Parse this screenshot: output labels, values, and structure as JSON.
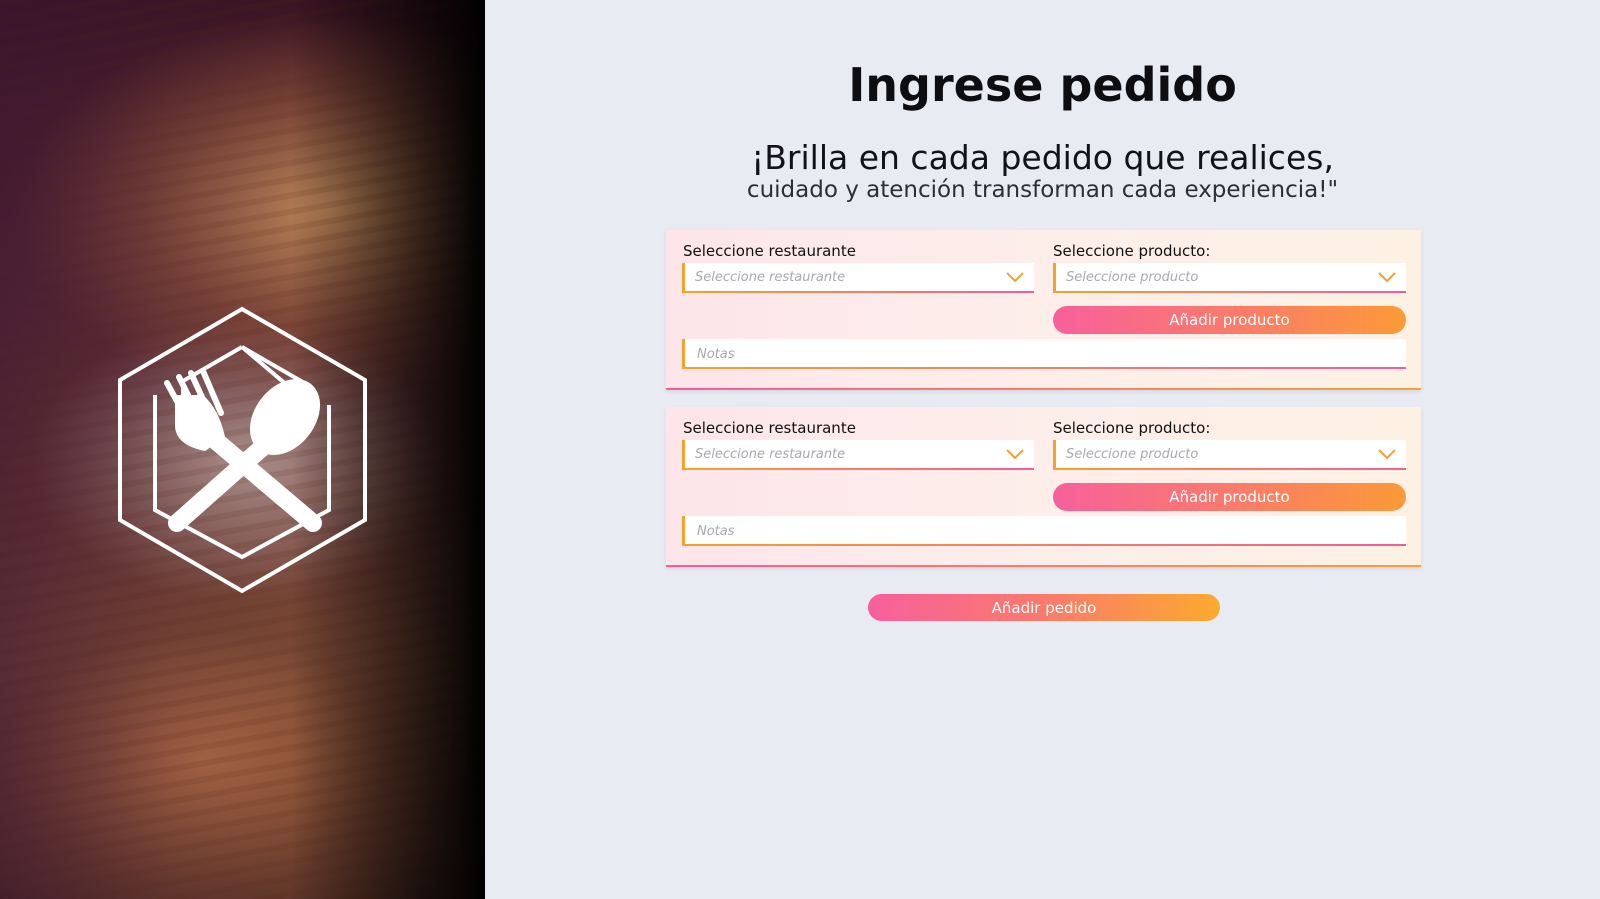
{
  "hero": {
    "image_description_icon": "fork-spoon-hexagon-icon"
  },
  "header": {
    "title": "Ingrese pedido",
    "tagline_line1": "¡Brilla en cada pedido que realices,",
    "tagline_line2": "cuidado y atención transforman cada experiencia!\""
  },
  "orders": [
    {
      "restaurant_label": "Seleccione restaurante",
      "restaurant_placeholder": "Seleccione restaurante",
      "product_label": "Seleccione producto:",
      "product_placeholder": "Seleccione producto",
      "add_product_label": "Añadir producto",
      "notes_placeholder": "Notas"
    },
    {
      "restaurant_label": "Seleccione restaurante",
      "restaurant_placeholder": "Seleccione restaurante",
      "product_label": "Seleccione producto:",
      "product_placeholder": "Seleccione producto",
      "add_product_label": "Añadir producto",
      "notes_placeholder": "Notas"
    }
  ],
  "footer": {
    "add_order_label": "Añadir pedido"
  },
  "colors": {
    "background": "#e8ebf2",
    "accent_pink": "#f7609c",
    "accent_orange": "#fb9a36",
    "card_bg": "#fdeeea"
  }
}
